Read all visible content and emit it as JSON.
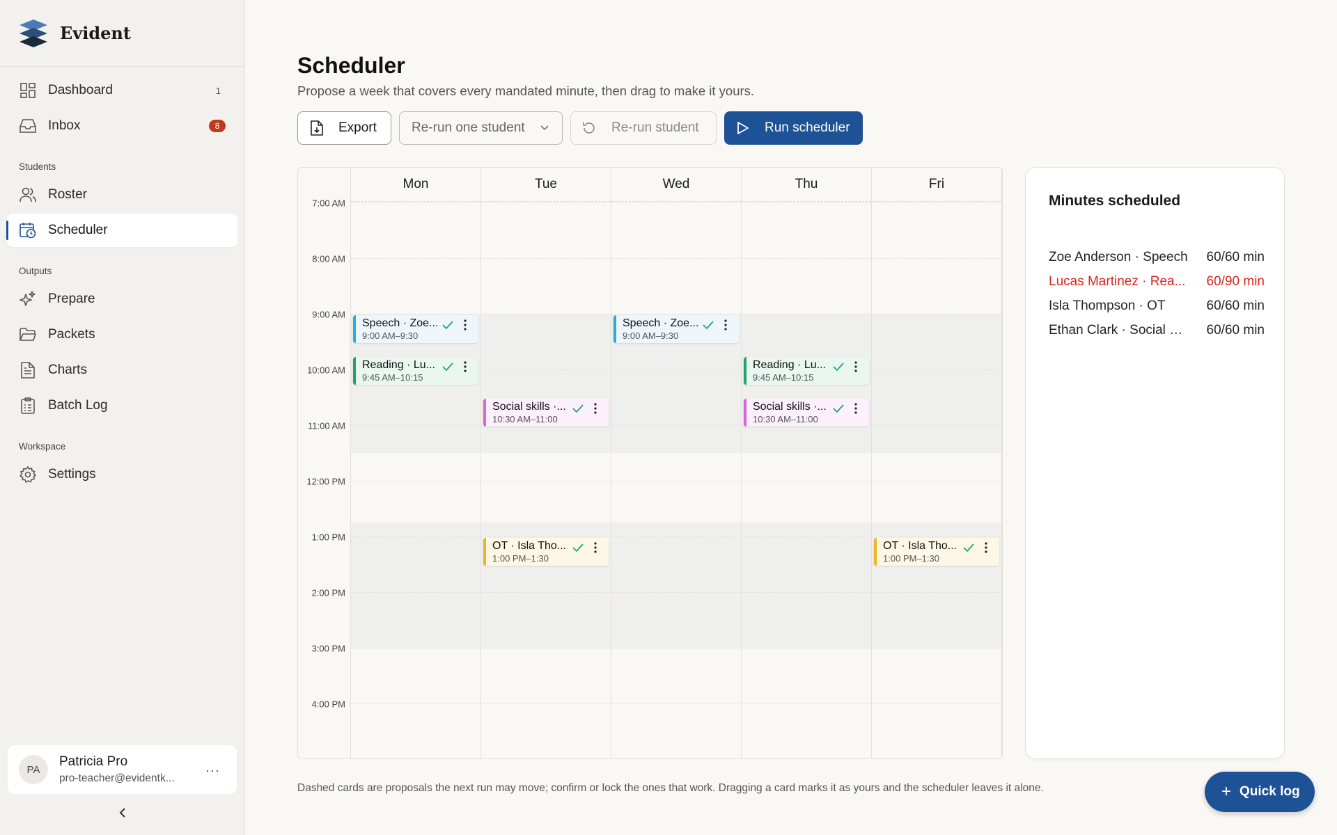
{
  "app": {
    "name": "Evident"
  },
  "sidebar": {
    "nav_top": [
      {
        "label": "Dashboard",
        "icon": "dashboard-icon",
        "count": "1"
      },
      {
        "label": "Inbox",
        "icon": "inbox-icon",
        "badge": "8"
      }
    ],
    "sections": [
      {
        "label": "Students",
        "items": [
          {
            "label": "Roster",
            "icon": "users-icon"
          },
          {
            "label": "Scheduler",
            "icon": "calendar-clock-icon",
            "active": true
          }
        ]
      },
      {
        "label": "Outputs",
        "items": [
          {
            "label": "Prepare",
            "icon": "sparkles-icon"
          },
          {
            "label": "Packets",
            "icon": "folder-icon"
          },
          {
            "label": "Charts",
            "icon": "document-icon"
          },
          {
            "label": "Batch Log",
            "icon": "clipboard-icon"
          }
        ]
      },
      {
        "label": "Workspace",
        "items": [
          {
            "label": "Settings",
            "icon": "gear-icon"
          }
        ]
      }
    ],
    "user": {
      "initials": "PA",
      "name": "Patricia Pro",
      "email": "pro-teacher@evidentk...",
      "more": "···"
    }
  },
  "page": {
    "title": "Scheduler",
    "subtitle": "Propose a week that covers every mandated minute, then drag to make it yours."
  },
  "toolbar": {
    "export_label": "Export",
    "rerun_select_label": "Re-run one student",
    "rerun_student_label": "Re-run student",
    "run_label": "Run scheduler"
  },
  "calendar": {
    "days": [
      "Mon",
      "Tue",
      "Wed",
      "Thu",
      "Fri"
    ],
    "times": [
      "7:00 AM",
      "8:00 AM",
      "9:00 AM",
      "10:00 AM",
      "11:00 AM",
      "12:00 PM",
      "1:00 PM",
      "2:00 PM",
      "3:00 PM",
      "4:00 PM"
    ],
    "events": [
      {
        "day": 0,
        "start": 9.0,
        "title": "Speech · Zoe...",
        "time": "9:00 AM–9:30",
        "color": "blue"
      },
      {
        "day": 0,
        "start": 9.75,
        "title": "Reading · Lu...",
        "time": "9:45 AM–10:15",
        "color": "green"
      },
      {
        "day": 1,
        "start": 10.5,
        "title": "Social skills ·...",
        "time": "10:30 AM–11:00",
        "color": "pink"
      },
      {
        "day": 1,
        "start": 13.0,
        "title": "OT · Isla Tho...",
        "time": "1:00 PM–1:30",
        "color": "yellow"
      },
      {
        "day": 2,
        "start": 9.0,
        "title": "Speech · Zoe...",
        "time": "9:00 AM–9:30",
        "color": "blue"
      },
      {
        "day": 3,
        "start": 9.75,
        "title": "Reading · Lu...",
        "time": "9:45 AM–10:15",
        "color": "green"
      },
      {
        "day": 3,
        "start": 10.5,
        "title": "Social skills ·...",
        "time": "10:30 AM–11:00",
        "color": "pink"
      },
      {
        "day": 4,
        "start": 13.0,
        "title": "OT · Isla Tho...",
        "time": "1:00 PM–1:30",
        "color": "yellow"
      }
    ]
  },
  "minutes": {
    "title": "Minutes scheduled",
    "rows": [
      {
        "name": "Zoe Anderson · Speech",
        "value": "60/60 min",
        "short": false
      },
      {
        "name": "Lucas Martinez · Rea...",
        "value": "60/90 min",
        "short": true
      },
      {
        "name": "Isla Thompson · OT",
        "value": "60/60 min",
        "short": false
      },
      {
        "name": "Ethan Clark · Social sk...",
        "value": "60/60 min",
        "short": false
      }
    ]
  },
  "footnote": "Dashed cards are proposals the next run may move; confirm or lock the ones that work. Dragging a card marks it as yours and the scheduler leaves it alone.",
  "quick_log_label": "Quick log",
  "colors": {
    "accent": "#1e5296",
    "shortfall": "#d9261c",
    "badge": "#c0391d"
  }
}
